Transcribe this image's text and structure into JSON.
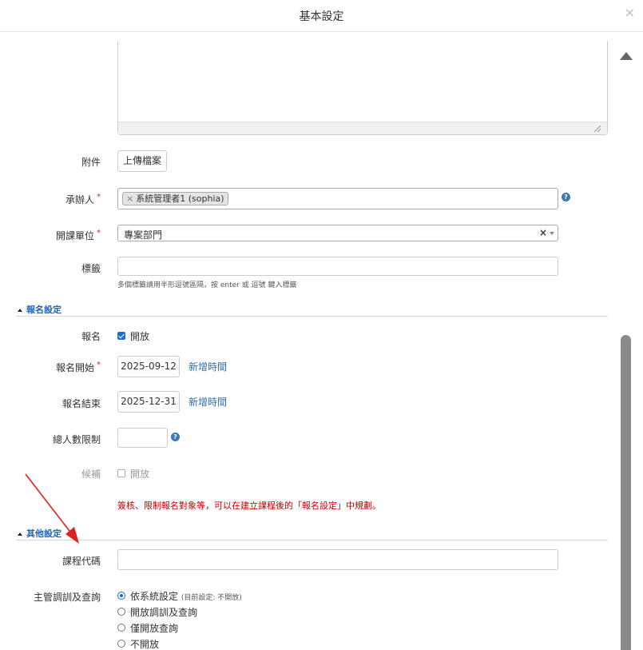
{
  "header": {
    "title": "基本設定",
    "close": "×"
  },
  "fields": {
    "attachment": {
      "label": "附件",
      "button": "上傳檔案"
    },
    "organizer": {
      "label": "承辦人",
      "required": "*",
      "chip": "系統管理者1 (sophia)",
      "chip_remove": "×",
      "help": "?"
    },
    "dept": {
      "label": "開課單位",
      "required": "*",
      "value": "專案部門",
      "clear": "×"
    },
    "tags": {
      "label": "標籤",
      "value": "",
      "hint": "多個標籤請用半形逗號區隔，按 enter 或 逗號 鍵入標籤"
    }
  },
  "registration": {
    "section": "報名設定",
    "enroll": {
      "label": "報名",
      "checkbox_label": "開放",
      "checked": true
    },
    "start": {
      "label": "報名開始",
      "required": "*",
      "value": "2025-09-12",
      "link": "新增時間"
    },
    "end": {
      "label": "報名結束",
      "value": "2025-12-31",
      "link": "新增時間"
    },
    "limit": {
      "label": "總人數限制",
      "value": "",
      "help": "?"
    },
    "waitlist": {
      "label": "候補",
      "checkbox_label": "開放",
      "checked": false
    },
    "note": "簽核、限制報名對象等，可以在建立課程後的「報名設定」中規劃。"
  },
  "other": {
    "section": "其他設定",
    "course_code": {
      "label": "課程代碼",
      "value": ""
    },
    "supervisor": {
      "label": "主管調訓及查詢",
      "options": [
        {
          "label": "依系統設定",
          "note": "(目前設定: 不開放)",
          "selected": true
        },
        {
          "label": "開放調訓及查詢",
          "selected": false
        },
        {
          "label": "僅開放查詢",
          "selected": false
        },
        {
          "label": "不開放",
          "selected": false
        }
      ]
    }
  },
  "colors": {
    "accent": "#1a6fd6",
    "link": "#2a6fb2",
    "note": "#c00000",
    "annotation": "#e02020"
  },
  "icons": {
    "help": "question-circle-icon",
    "arrow": "annotation-arrow-icon",
    "scroll": "scroll-up-icon"
  }
}
